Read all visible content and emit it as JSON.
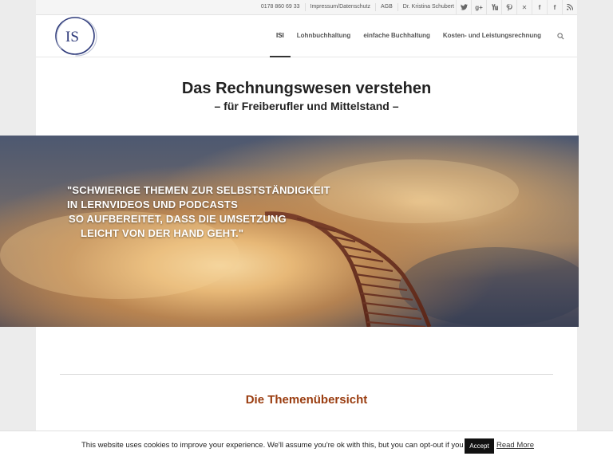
{
  "topbar": {
    "phone": "0178 860 69 33",
    "links": [
      "Impressum/Datenschutz",
      "AGB",
      "Dr. Kristina Schubert"
    ],
    "social_icons": [
      "twitter-icon",
      "google-plus-icon",
      "youtube-icon",
      "pinterest-icon",
      "xing-icon",
      "facebook-icon",
      "facebook-icon",
      "rss-icon"
    ]
  },
  "header": {
    "logo_text": "IS",
    "nav": [
      "ISI",
      "Lohnbuchhaltung",
      "einfache Buchhaltung",
      "Kosten- und Leistungsrechnung"
    ],
    "active_nav": "ISI",
    "search_icon": "search-icon"
  },
  "title": {
    "main": "Das Rechnungswesen verstehen",
    "sub": "– für Freiberufler und Mittelstand –"
  },
  "hero": {
    "quote_lines": [
      "\"SCHWIERIGE THEMEN ZUR SELBSTSTÄNDIGKEIT",
      "IN LERNVIDEOS UND PODCASTS",
      "SO AUFBEREITET, DASS DIE UMSETZUNG",
      "LEICHT VON DER HAND GEHT.\""
    ]
  },
  "section": {
    "title": "Die Themenübersicht"
  },
  "cookie": {
    "message": "This website uses cookies to improve your experience. We'll assume you're ok with this, but you can opt-out if you wish.",
    "accept": "Accept",
    "read_more": "Read More"
  },
  "colors": {
    "accent": "#9a3d10",
    "logo_blue": "#2e3a7a"
  }
}
